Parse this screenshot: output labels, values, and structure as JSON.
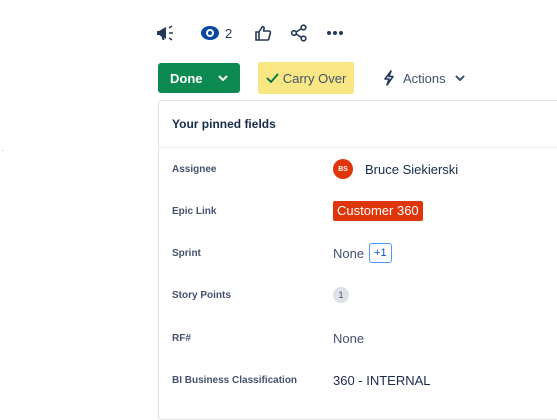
{
  "toolbar": {
    "feedback_icon": "megaphone-icon",
    "watch_icon": "eye-icon",
    "watchers_count": "2",
    "like_icon": "thumbs-up-icon",
    "share_icon": "share-icon",
    "more_icon": "more-icon"
  },
  "status": {
    "done_label": "Done",
    "carry_over_label": "Carry Over",
    "actions_label": "Actions",
    "colors": {
      "done_bg": "#0d8a52",
      "carry_over_bg": "#f9e784"
    }
  },
  "pinned": {
    "title": "Your pinned fields",
    "fields": [
      {
        "label": "Assignee",
        "avatar_initials": "BS",
        "value": "Bruce Siekierski"
      },
      {
        "label": "Epic Link",
        "value": "Customer 360"
      },
      {
        "label": "Sprint",
        "value": "None",
        "extra": "+1"
      },
      {
        "label": "Story Points",
        "value": "1"
      },
      {
        "label": "RF#",
        "value": "None"
      },
      {
        "label": "BI Business Classification",
        "value": "360 - INTERNAL"
      }
    ]
  }
}
